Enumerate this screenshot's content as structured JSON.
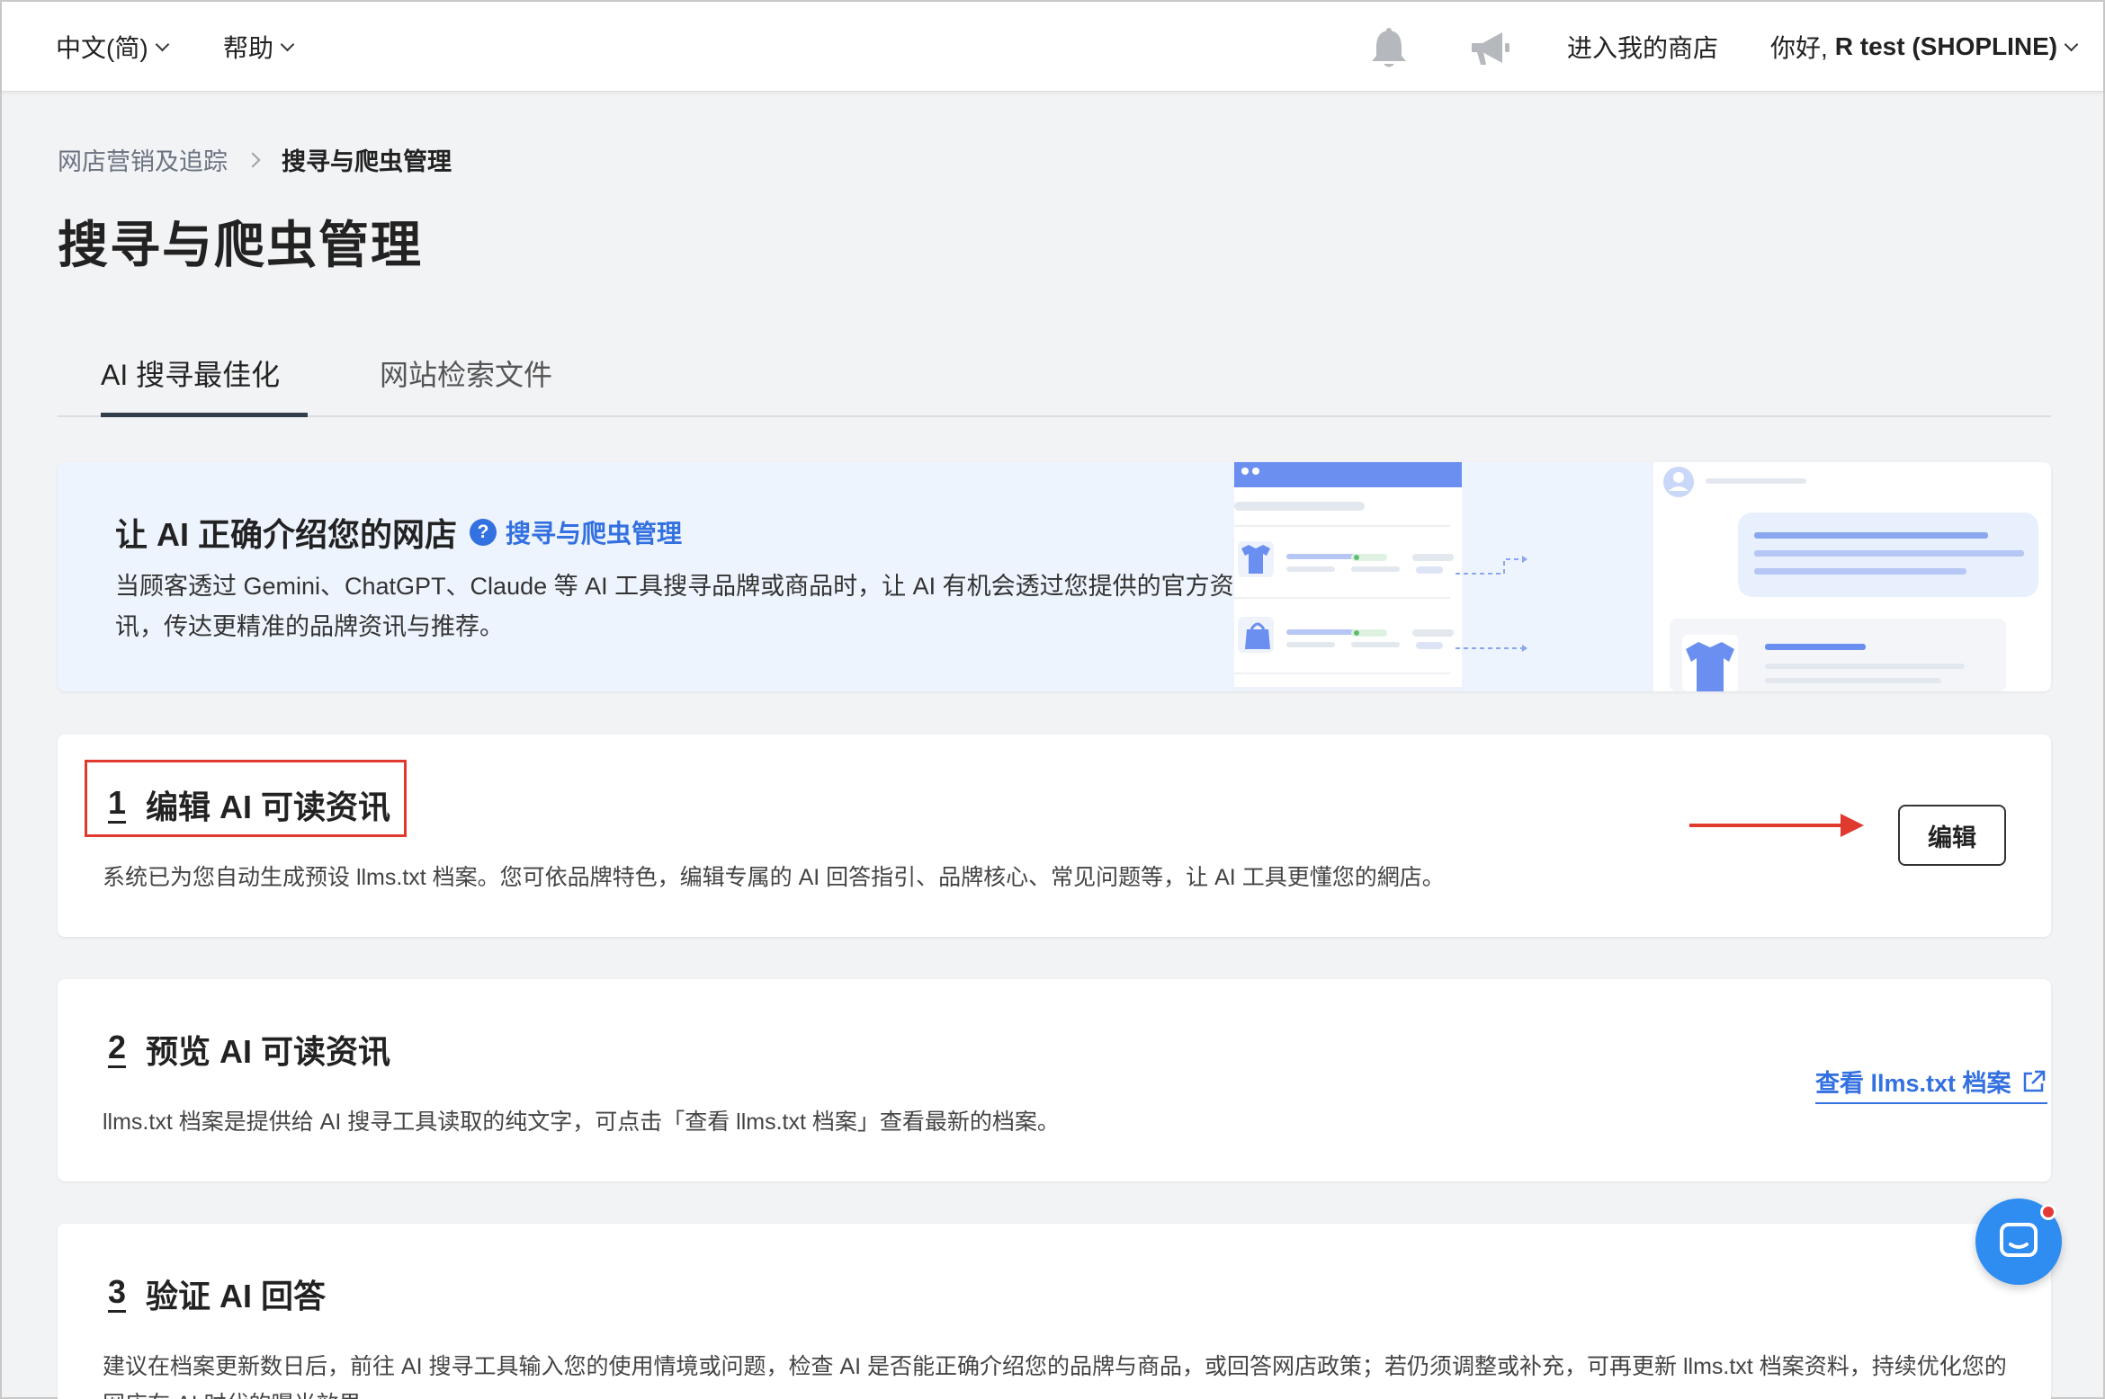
{
  "topbar": {
    "language": "中文(简)",
    "help": "帮助",
    "enter_store": "进入我的商店",
    "greeting_prefix": "你好,",
    "user_name": "R test (SHOPLINE)",
    "icons": [
      "bell-icon",
      "megaphone-icon"
    ]
  },
  "breadcrumb": {
    "parent": "网店营销及追踪",
    "current": "搜寻与爬虫管理"
  },
  "page_title": "搜寻与爬虫管理",
  "tabs": [
    {
      "label": "AI 搜寻最佳化",
      "active": true
    },
    {
      "label": "网站检索文件",
      "active": false
    }
  ],
  "hero": {
    "title": "让 AI 正确介绍您的网店",
    "help_link": "搜寻与爬虫管理",
    "description": "当顾客透过 Gemini、ChatGPT、Claude 等 AI 工具搜寻品牌或商品时，让 AI 有机会透过您提供的官方资讯，传达更精准的品牌资讯与推荐。"
  },
  "steps": [
    {
      "number": "1",
      "title": "编辑 AI 可读资讯",
      "description": "系统已为您自动生成预设 llms.txt 档案。您可依品牌特色，编辑专属的 AI 回答指引、品牌核心、常见问题等，让 AI 工具更懂您的網店。",
      "action": "编辑"
    },
    {
      "number": "2",
      "title": "预览 AI 可读资讯",
      "description": "llms.txt 档案是提供给 AI 搜寻工具读取的纯文字，可点击「查看 llms.txt 档案」查看最新的档案。",
      "action": "查看 llms.txt 档案"
    },
    {
      "number": "3",
      "title": "验证 AI 回答",
      "description": "建议在档案更新数日后，前往 AI 搜寻工具输入您的使用情境或问题，检查 AI 是否能正确介绍您的品牌与商品，或回答网店政策；若仍须调整或补充，可再更新 llms.txt 档案资料，持续优化您的网店在 AI 时代的曝光效果。"
    }
  ],
  "colors": {
    "accent": "#3370e0",
    "highlight": "#e0392d",
    "chat": "#2f8cf0"
  }
}
